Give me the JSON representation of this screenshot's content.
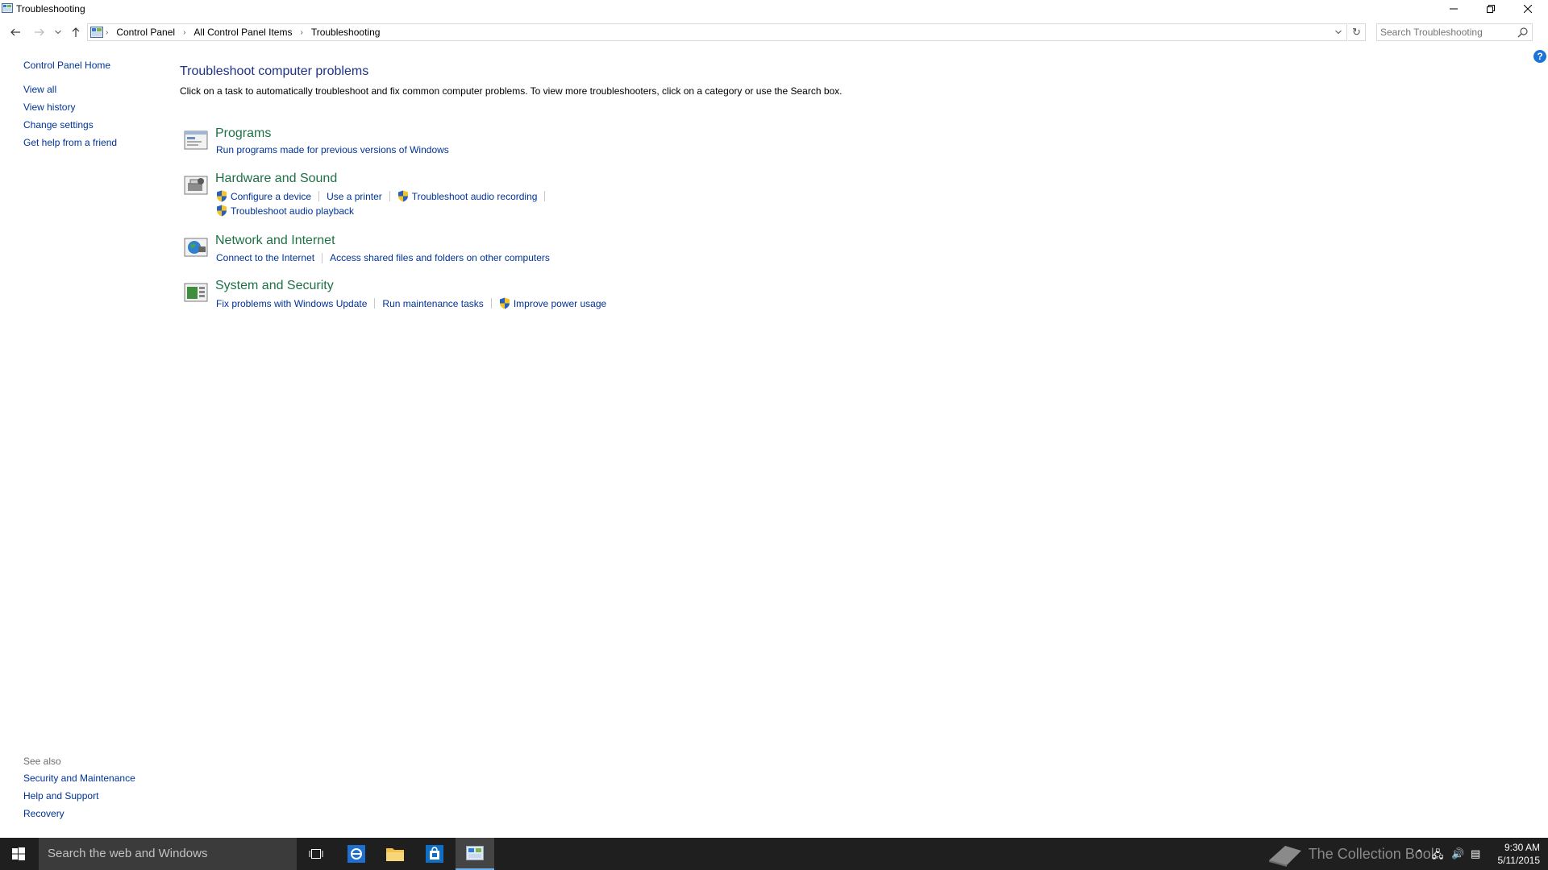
{
  "window": {
    "title": "Troubleshooting",
    "controls": {
      "minimize": "—",
      "restore": "❐",
      "close": "✕"
    }
  },
  "addressbar": {
    "crumbs": [
      "Control Panel",
      "All Control Panel Items",
      "Troubleshooting"
    ],
    "search_placeholder": "Search Troubleshooting"
  },
  "sidebar": {
    "home": "Control Panel Home",
    "items": [
      "View all",
      "View history",
      "Change settings",
      "Get help from a friend"
    ],
    "see_also_header": "See also",
    "see_also": [
      "Security and Maintenance",
      "Help and Support",
      "Recovery"
    ]
  },
  "main": {
    "heading": "Troubleshoot computer problems",
    "description": "Click on a task to automatically troubleshoot and fix common computer problems. To view more troubleshooters, click on a category or use the Search box.",
    "categories": [
      {
        "title": "Programs",
        "links": [
          "Run programs made for previous versions of Windows"
        ]
      },
      {
        "title": "Hardware and Sound",
        "links": [
          "Configure a device",
          "Use a printer",
          "Troubleshoot audio recording",
          "Troubleshoot audio playback"
        ]
      },
      {
        "title": "Network and Internet",
        "links": [
          "Connect to the Internet",
          "Access shared files and folders on other computers"
        ]
      },
      {
        "title": "System and Security",
        "links": [
          "Fix problems with Windows Update",
          "Run maintenance tasks",
          "Improve power usage"
        ]
      }
    ]
  },
  "taskbar": {
    "search_text": "Search the web and Windows",
    "watermark": "The Collection Book",
    "time": "9:30 AM",
    "date": "5/11/2015"
  },
  "colors": {
    "link": "#003399",
    "category_title": "#1e7145",
    "heading": "#1e3287",
    "taskbar_bg": "#1f1f1f"
  }
}
